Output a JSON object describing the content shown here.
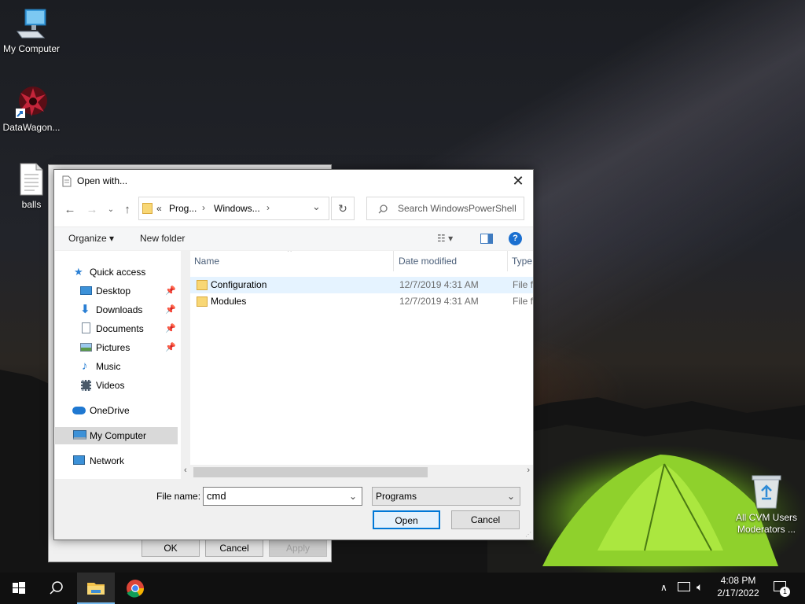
{
  "desktop": {
    "icons": [
      {
        "label": "My Computer"
      },
      {
        "label": "DataWagon..."
      },
      {
        "label": "balls"
      },
      {
        "label": "All CVM Users Moderators ..."
      }
    ]
  },
  "back_dialog": {
    "ok_label": "OK",
    "cancel_label": "Cancel",
    "apply_label": "Apply"
  },
  "dialog": {
    "title": "Open with...",
    "address": {
      "overflow": "«",
      "segments": [
        "Prog...",
        "Windows..."
      ],
      "separator": "›"
    },
    "search_placeholder": "Search WindowsPowerShell",
    "toolbar": {
      "organize_label": "Organize ▾",
      "new_folder_label": "New folder"
    },
    "nav": {
      "quick_access": "Quick access",
      "items": [
        "Desktop",
        "Downloads",
        "Documents",
        "Pictures",
        "Music",
        "Videos"
      ],
      "onedrive": "OneDrive",
      "my_computer": "My Computer",
      "network": "Network"
    },
    "columns": {
      "name": "Name",
      "date_modified": "Date modified",
      "type": "Type"
    },
    "files": [
      {
        "name": "Configuration",
        "date": "12/7/2019 4:31 AM",
        "type": "File fo"
      },
      {
        "name": "Modules",
        "date": "12/7/2019 4:31 AM",
        "type": "File fo"
      }
    ],
    "file_name_label": "File name:",
    "file_name_value": "cmd",
    "file_type_value": "Programs",
    "open_label": "Open",
    "cancel_label": "Cancel"
  },
  "taskbar": {
    "time": "4:08 PM",
    "date": "2/17/2022",
    "notification_count": "1"
  },
  "colors": {
    "accent": "#0078d7",
    "selection": "#d9d9d9",
    "hover": "#e5f3ff"
  }
}
